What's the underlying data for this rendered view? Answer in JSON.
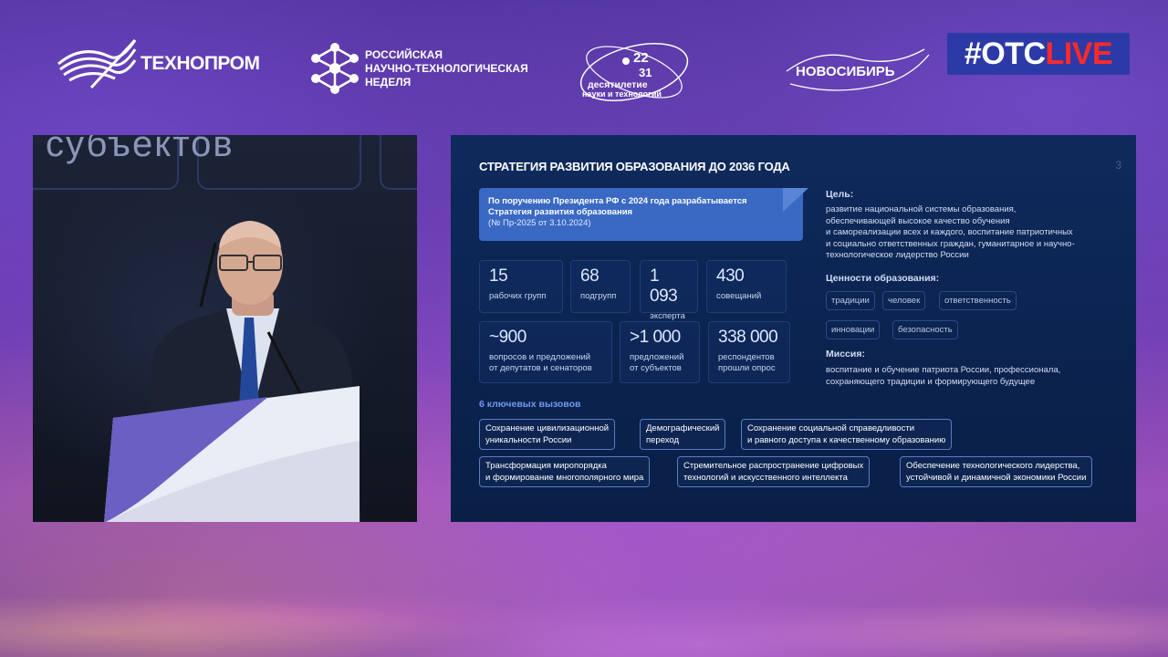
{
  "logos": {
    "technoprom": "ТЕХНОПРОМ",
    "rntn": [
      "РОССИЙСКАЯ",
      "НАУЧНО-ТЕХНОЛОГИЧЕСКАЯ",
      "НЕДЕЛЯ"
    ],
    "decade_top": "22",
    "decade_bottom": "31",
    "decade_line1": "десятилетие",
    "decade_line2": "науки и технологий",
    "novosibirsk": "НОВОСИБИРЬ",
    "otc_hash": "#OTC",
    "otc_live": "LIVE"
  },
  "video": {
    "background_text": "субъектов"
  },
  "slide": {
    "title": "СТРАТЕГИЯ РАЗВИТИЯ ОБРАЗОВАНИЯ ДО 2036 ГОДА",
    "page_number": "3",
    "banner": {
      "line1": "По поручению Президента РФ с 2024 года разрабатывается",
      "line2": "Стратегия развития образования",
      "line3": "(№ Пр-2025 от 3.10.2024)"
    },
    "stats": [
      {
        "num": "15",
        "label": "рабочих групп"
      },
      {
        "num": "68",
        "label": "подгрупп"
      },
      {
        "num": "1 093",
        "label": "эксперта"
      },
      {
        "num": "430",
        "label": "совещаний"
      },
      {
        "num": "~900",
        "label": "вопросов и предложений\nот депутатов и сенаторов"
      },
      {
        "num": ">1 000",
        "label": "предложений\nот субъектов"
      },
      {
        "num": "338 000",
        "label": "респондентов\nпрошли опрос"
      }
    ],
    "goal_heading": "Цель:",
    "goal_text": "развитие национальной системы образования,\nобеспечивающей высокое качество обучения\nи самореализации всех и каждого, воспитание патриотичных\nи социально ответственных граждан, гуманитарное и научно-\nтехнологическое лидерство России",
    "values_heading": "Ценности образования:",
    "values": [
      "традиции",
      "человек",
      "ответственность",
      "инновации",
      "безопасность"
    ],
    "mission_heading": "Миссия:",
    "mission_text": "воспитание и обучение патриота России, профессионала,\nсохраняющего традиции и формирующего будущее",
    "challenges_heading": "6 ключевых вызовов",
    "challenges": [
      "Сохранение цивилизационной\nуникальности России",
      "Демографический\nпереход",
      "Сохранение социальной справедливости\nи равного доступа к качественному образованию",
      "Трансформация миропорядка\nи формирование многополярного мира",
      "Стремительное распространение цифровых\nтехнологий и искусственного интеллекта",
      "Обеспечение технологического лидерства,\nустойчивой и динамичной экономики России"
    ]
  }
}
